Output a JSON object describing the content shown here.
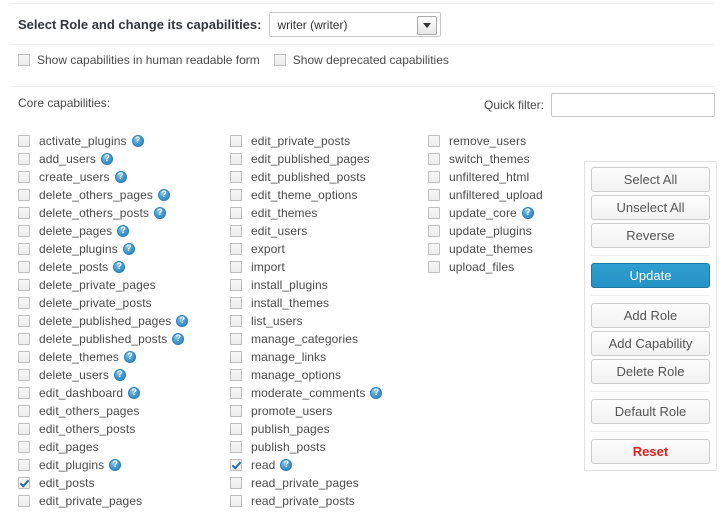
{
  "header": {
    "role_label": "Select Role and change its capabilities:",
    "role_value": "writer (writer)",
    "role_options": [
      "writer (writer)"
    ],
    "options": [
      {
        "label": "Show capabilities in human readable form",
        "checked": false
      },
      {
        "label": "Show deprecated capabilities",
        "checked": false
      }
    ]
  },
  "core": {
    "title": "Core capabilities:",
    "filter_label": "Quick filter:",
    "filter_value": "",
    "filter_placeholder": ""
  },
  "columns": [
    {
      "items": [
        {
          "name": "activate_plugins",
          "checked": false,
          "help": true
        },
        {
          "name": "add_users",
          "checked": false,
          "help": true
        },
        {
          "name": "create_users",
          "checked": false,
          "help": true
        },
        {
          "name": "delete_others_pages",
          "checked": false,
          "help": true
        },
        {
          "name": "delete_others_posts",
          "checked": false,
          "help": true
        },
        {
          "name": "delete_pages",
          "checked": false,
          "help": true
        },
        {
          "name": "delete_plugins",
          "checked": false,
          "help": true
        },
        {
          "name": "delete_posts",
          "checked": false,
          "help": true
        },
        {
          "name": "delete_private_pages",
          "checked": false,
          "help": false
        },
        {
          "name": "delete_private_posts",
          "checked": false,
          "help": false
        },
        {
          "name": "delete_published_pages",
          "checked": false,
          "help": true
        },
        {
          "name": "delete_published_posts",
          "checked": false,
          "help": true
        },
        {
          "name": "delete_themes",
          "checked": false,
          "help": true
        },
        {
          "name": "delete_users",
          "checked": false,
          "help": true
        },
        {
          "name": "edit_dashboard",
          "checked": false,
          "help": true
        },
        {
          "name": "edit_others_pages",
          "checked": false,
          "help": false
        },
        {
          "name": "edit_others_posts",
          "checked": false,
          "help": false
        },
        {
          "name": "edit_pages",
          "checked": false,
          "help": false
        },
        {
          "name": "edit_plugins",
          "checked": false,
          "help": true
        },
        {
          "name": "edit_posts",
          "checked": true,
          "help": false
        },
        {
          "name": "edit_private_pages",
          "checked": false,
          "help": false
        }
      ]
    },
    {
      "items": [
        {
          "name": "edit_private_posts",
          "checked": false,
          "help": false
        },
        {
          "name": "edit_published_pages",
          "checked": false,
          "help": false
        },
        {
          "name": "edit_published_posts",
          "checked": false,
          "help": false
        },
        {
          "name": "edit_theme_options",
          "checked": false,
          "help": false
        },
        {
          "name": "edit_themes",
          "checked": false,
          "help": false
        },
        {
          "name": "edit_users",
          "checked": false,
          "help": false
        },
        {
          "name": "export",
          "checked": false,
          "help": false
        },
        {
          "name": "import",
          "checked": false,
          "help": false
        },
        {
          "name": "install_plugins",
          "checked": false,
          "help": false
        },
        {
          "name": "install_themes",
          "checked": false,
          "help": false
        },
        {
          "name": "list_users",
          "checked": false,
          "help": false
        },
        {
          "name": "manage_categories",
          "checked": false,
          "help": false
        },
        {
          "name": "manage_links",
          "checked": false,
          "help": false
        },
        {
          "name": "manage_options",
          "checked": false,
          "help": false
        },
        {
          "name": "moderate_comments",
          "checked": false,
          "help": true
        },
        {
          "name": "promote_users",
          "checked": false,
          "help": false
        },
        {
          "name": "publish_pages",
          "checked": false,
          "help": false
        },
        {
          "name": "publish_posts",
          "checked": false,
          "help": false
        },
        {
          "name": "read",
          "checked": true,
          "help": true
        },
        {
          "name": "read_private_pages",
          "checked": false,
          "help": false
        },
        {
          "name": "read_private_posts",
          "checked": false,
          "help": false
        }
      ]
    },
    {
      "items": [
        {
          "name": "remove_users",
          "checked": false,
          "help": false
        },
        {
          "name": "switch_themes",
          "checked": false,
          "help": false
        },
        {
          "name": "unfiltered_html",
          "checked": false,
          "help": false
        },
        {
          "name": "unfiltered_upload",
          "checked": false,
          "help": false
        },
        {
          "name": "update_core",
          "checked": false,
          "help": true
        },
        {
          "name": "update_plugins",
          "checked": false,
          "help": false
        },
        {
          "name": "update_themes",
          "checked": false,
          "help": false
        },
        {
          "name": "upload_files",
          "checked": false,
          "help": false
        }
      ]
    }
  ],
  "panel": {
    "groups": [
      {
        "buttons": [
          {
            "label": "Select All",
            "style": "default"
          },
          {
            "label": "Unselect All",
            "style": "default"
          },
          {
            "label": "Reverse",
            "style": "default"
          }
        ]
      },
      {
        "buttons": [
          {
            "label": "Update",
            "style": "primary"
          }
        ]
      },
      {
        "buttons": [
          {
            "label": "Add Role",
            "style": "default"
          },
          {
            "label": "Add Capability",
            "style": "default"
          },
          {
            "label": "Delete Role",
            "style": "default"
          }
        ]
      },
      {
        "buttons": [
          {
            "label": "Default Role",
            "style": "default"
          }
        ]
      },
      {
        "buttons": [
          {
            "label": "Reset",
            "style": "danger"
          }
        ]
      }
    ]
  },
  "colors": {
    "primary": "#2492c4",
    "danger": "#e02020",
    "help_icon": "#2a7fb8",
    "text": "#4a4a4a"
  }
}
